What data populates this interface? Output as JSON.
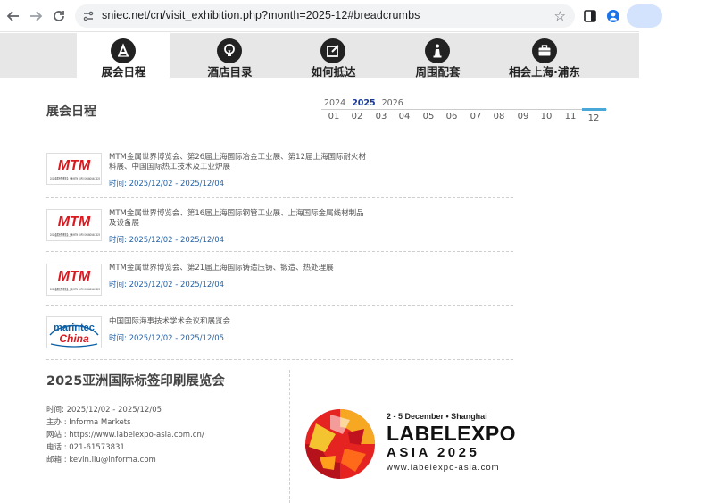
{
  "browser": {
    "url": "sniec.net/cn/visit_exhibition.php?month=2025-12#breadcrumbs",
    "icons": [
      "back-arrow-icon",
      "forward-arrow-icon",
      "reload-icon",
      "site-settings-icon",
      "bookmark-star-icon",
      "side-panel-icon",
      "profile-icon"
    ]
  },
  "nav": {
    "tabs": [
      {
        "label": "展会日程",
        "icon": "calendar-a-icon",
        "active": true
      },
      {
        "label": "酒店目录",
        "icon": "lightbulb-icon",
        "active": false
      },
      {
        "label": "如何抵达",
        "icon": "edit-square-icon",
        "active": false
      },
      {
        "label": "周围配套",
        "icon": "info-chess-icon",
        "active": false
      },
      {
        "label": "相会上海·浦东",
        "icon": "briefcase-icon",
        "active": false
      }
    ]
  },
  "schedule": {
    "title": "展会日程",
    "years": [
      "2024",
      "2025",
      "2026"
    ],
    "current_year": "2025",
    "months": [
      "01",
      "02",
      "03",
      "04",
      "05",
      "06",
      "07",
      "08",
      "09",
      "10",
      "11",
      "12"
    ],
    "current_month": "12"
  },
  "events": [
    {
      "title": "MTM金属世界博览会、第26届上海国际冶金工业展、第12届上海国际耐火材料展、中国国际热工技术及工业炉展",
      "time": "时间: 2025/12/02 - 2025/12/04",
      "logo": "MTM",
      "logo_sub": "2025金属世界博览会 上海 MTM EXPO SHANGHAI 2025"
    },
    {
      "title": "MTM金属世界博览会、第16届上海国际钢管工业展、上海国际金属线材制品及设备展",
      "time": "时间: 2025/12/02 - 2025/12/04",
      "logo": "MTM",
      "logo_sub": "2025金属世界博览会 上海 MTM EXPO SHANGHAI 2025"
    },
    {
      "title": "MTM金属世界博览会、第21届上海国际铸造压铸、锻造、热处理展",
      "time": "时间: 2025/12/02 - 2025/12/04",
      "logo": "MTM",
      "logo_sub": "2025金属世界博览会 上海 MTM EXPO SHANGHAI 2025"
    },
    {
      "title": "中国国际海事技术学术会议和展览会",
      "time": "时间: 2025/12/02 - 2025/12/05",
      "logo": "marintec China",
      "logo_sub": ""
    }
  ],
  "featured": {
    "title": "2025亚洲国际标签印刷展览会",
    "time": "时间: 2025/12/02 - 2025/12/05",
    "organizer": "主办 : Informa Markets",
    "website": "网站 : https://www.labelexpo-asia.com.cn/",
    "phone": "电话 : 021-61573831",
    "email": "邮箱 : kevin.liu@informa.com",
    "banner": {
      "date": "2 - 5 December • Shanghai",
      "name": "LABELEXPO",
      "year": "ASIA 2025",
      "url": "www.labelexpo-asia.com"
    }
  },
  "colors": {
    "accent": "#49a8d8",
    "link": "#2563a8",
    "year_active": "#1a3a9a",
    "mtm_red": "#d71920",
    "nav_bg": "#e7e7e7"
  }
}
